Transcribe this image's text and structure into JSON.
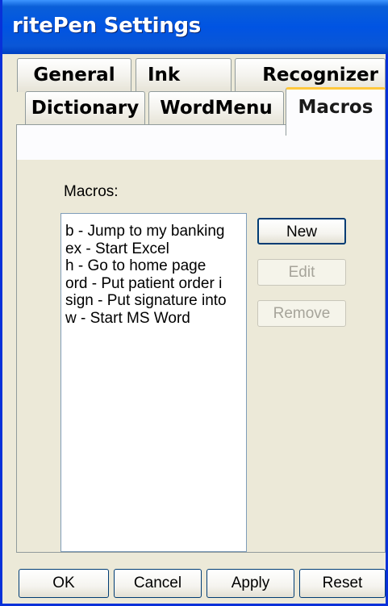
{
  "window": {
    "title": "ritePen Settings"
  },
  "tabs": {
    "general": "General",
    "ink": "Ink",
    "recognizer": "Recognizer",
    "dictionary": "Dictionary",
    "wordmenu": "WordMenu",
    "macros": "Macros",
    "selected": "Macros"
  },
  "macros_panel": {
    "label": "Macros:",
    "items": [
      "b - Jump to my banking",
      "ex - Start Excel",
      "h - Go to home page",
      "ord - Put patient order i",
      "sign - Put signature into",
      "w - Start MS Word"
    ],
    "new_button": "New",
    "edit_button": "Edit",
    "remove_button": "Remove"
  },
  "footer": {
    "ok_button": "OK",
    "cancel_button": "Cancel",
    "apply_button": "Apply",
    "reset_button": "Reset"
  },
  "colors": {
    "titlebar": "#0054e3",
    "dialog_background": "#ece9d8",
    "selected_tab_accent": "#ffc83c",
    "button_border": "#003c74"
  }
}
